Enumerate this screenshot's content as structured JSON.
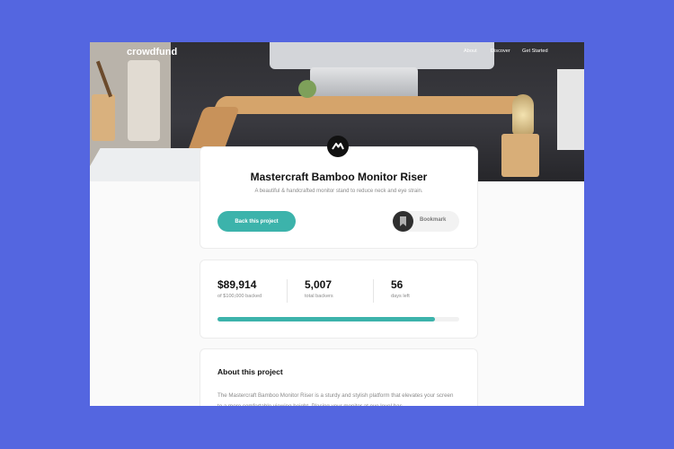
{
  "nav": {
    "logo": "crowdfund",
    "links": [
      "About",
      "Discover",
      "Get Started"
    ]
  },
  "project": {
    "title": "Mastercraft Bamboo Monitor Riser",
    "subtitle": "A beautiful & handcrafted monitor stand to reduce neck and eye strain.",
    "back_label": "Back this project",
    "bookmark_label": "Bookmark"
  },
  "stats": {
    "backed_value": "$89,914",
    "backed_label": "of $100,000 backed",
    "backers_value": "5,007",
    "backers_label": "total backers",
    "days_value": "56",
    "days_label": "days left",
    "progress_percent": 89.9
  },
  "about": {
    "title": "About this project",
    "text": "The Mastercraft Bamboo Monitor Riser is a sturdy and stylish platform that elevates your screen to a more comfortable viewing height. Placing your monitor at eye level has"
  },
  "colors": {
    "background": "#5466e0",
    "accent": "#3cb3ab"
  }
}
